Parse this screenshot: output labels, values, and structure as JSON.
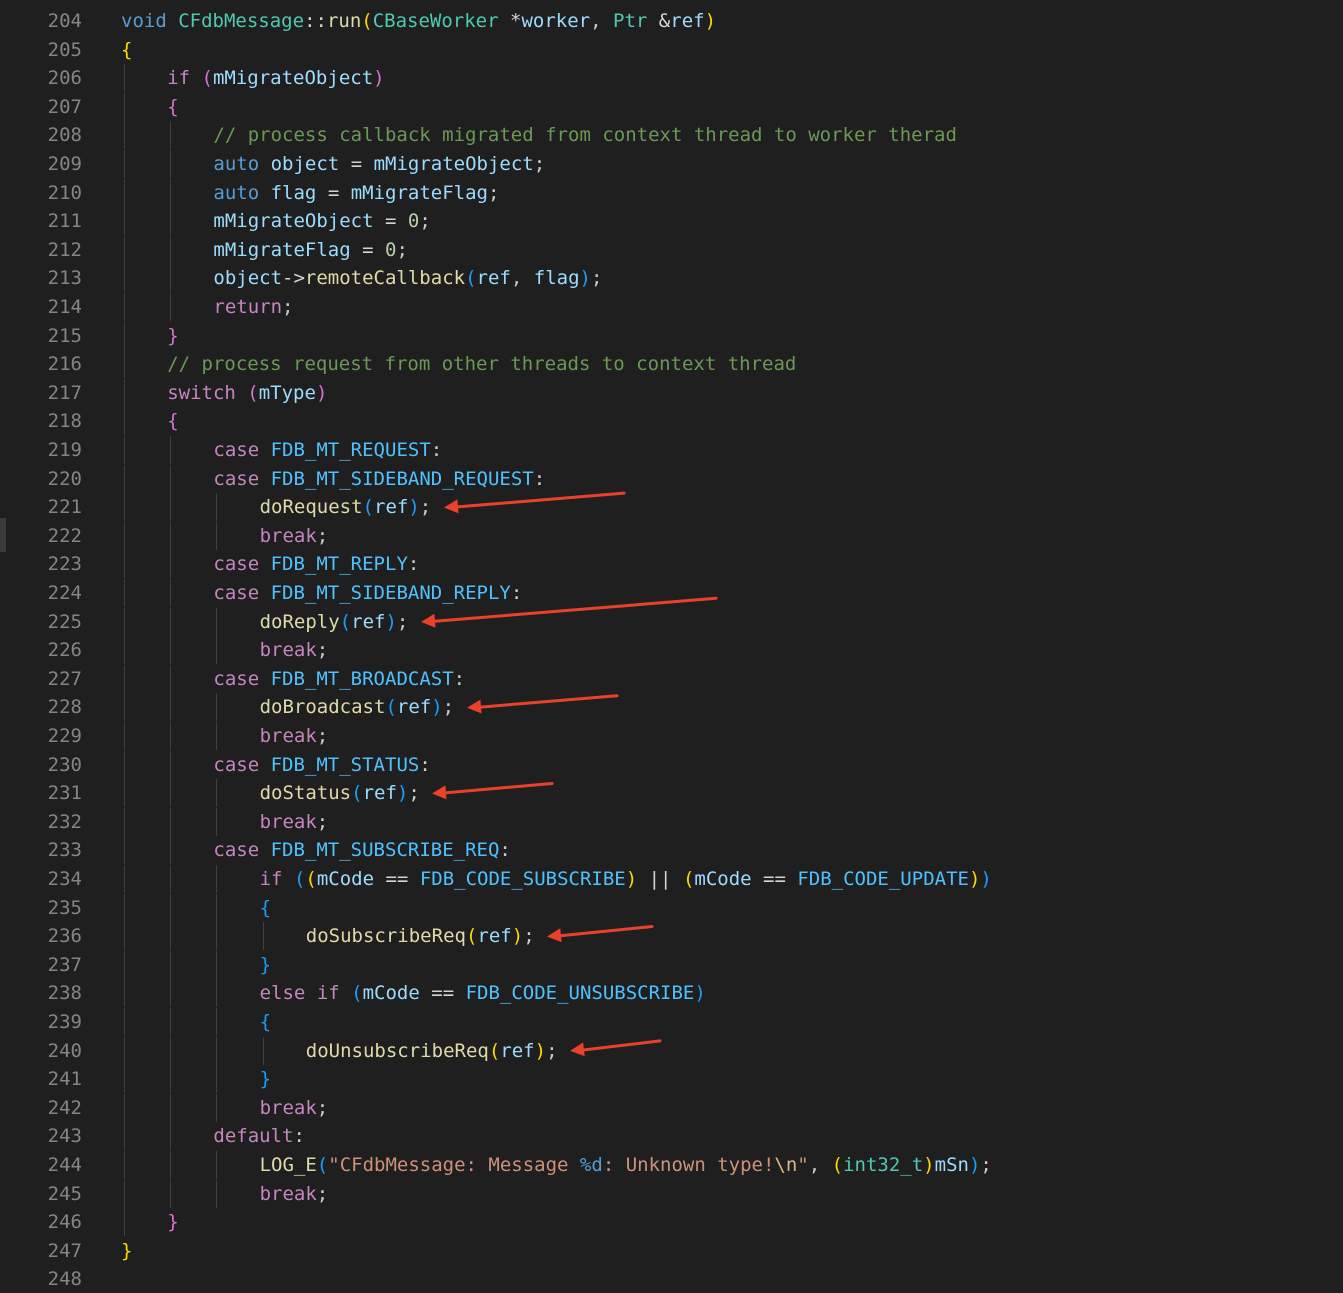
{
  "editor": {
    "lines": [
      {
        "n": "204",
        "indent": 0,
        "tokens": [
          [
            "kw",
            "void"
          ],
          [
            "",
            " "
          ],
          [
            "typ",
            "CFdbMessage"
          ],
          [
            "op",
            "::"
          ],
          [
            "fn",
            "run"
          ],
          [
            "b1",
            "("
          ],
          [
            "typ",
            "CBaseWorker"
          ],
          [
            "",
            " "
          ],
          [
            "op",
            "*"
          ],
          [
            "var",
            "worker"
          ],
          [
            "",
            ", "
          ],
          [
            "typ",
            "Ptr"
          ],
          [
            "",
            " "
          ],
          [
            "op",
            "&"
          ],
          [
            "var",
            "ref"
          ],
          [
            "b1",
            ")"
          ]
        ]
      },
      {
        "n": "205",
        "indent": 0,
        "tokens": [
          [
            "b1",
            "{"
          ]
        ]
      },
      {
        "n": "206",
        "indent": 1,
        "tokens": [
          [
            "ctl",
            "if"
          ],
          [
            "",
            " "
          ],
          [
            "b2",
            "("
          ],
          [
            "var",
            "mMigrateObject"
          ],
          [
            "b2",
            ")"
          ]
        ]
      },
      {
        "n": "207",
        "indent": 1,
        "tokens": [
          [
            "b2",
            "{"
          ]
        ]
      },
      {
        "n": "208",
        "indent": 2,
        "tokens": [
          [
            "cmt",
            "// process callback migrated from context thread to worker therad"
          ]
        ]
      },
      {
        "n": "209",
        "indent": 2,
        "tokens": [
          [
            "kw",
            "auto"
          ],
          [
            "",
            " "
          ],
          [
            "var",
            "object"
          ],
          [
            "op",
            " = "
          ],
          [
            "var",
            "mMigrateObject"
          ],
          [
            "",
            ";"
          ]
        ]
      },
      {
        "n": "210",
        "indent": 2,
        "tokens": [
          [
            "kw",
            "auto"
          ],
          [
            "",
            " "
          ],
          [
            "var",
            "flag"
          ],
          [
            "op",
            " = "
          ],
          [
            "var",
            "mMigrateFlag"
          ],
          [
            "",
            ";"
          ]
        ]
      },
      {
        "n": "211",
        "indent": 2,
        "tokens": [
          [
            "var",
            "mMigrateObject"
          ],
          [
            "op",
            " = "
          ],
          [
            "num",
            "0"
          ],
          [
            "",
            ";"
          ]
        ]
      },
      {
        "n": "212",
        "indent": 2,
        "tokens": [
          [
            "var",
            "mMigrateFlag"
          ],
          [
            "op",
            " = "
          ],
          [
            "num",
            "0"
          ],
          [
            "",
            ";"
          ]
        ]
      },
      {
        "n": "213",
        "indent": 2,
        "tokens": [
          [
            "var",
            "object"
          ],
          [
            "op",
            "->"
          ],
          [
            "fn",
            "remoteCallback"
          ],
          [
            "b3",
            "("
          ],
          [
            "var",
            "ref"
          ],
          [
            "",
            ", "
          ],
          [
            "var",
            "flag"
          ],
          [
            "b3",
            ")"
          ],
          [
            "",
            ";"
          ]
        ]
      },
      {
        "n": "214",
        "indent": 2,
        "tokens": [
          [
            "ctl",
            "return"
          ],
          [
            "",
            ";"
          ]
        ]
      },
      {
        "n": "215",
        "indent": 1,
        "tokens": [
          [
            "b2",
            "}"
          ]
        ]
      },
      {
        "n": "216",
        "indent": 1,
        "tokens": [
          [
            "cmt",
            "// process request from other threads to context thread"
          ]
        ]
      },
      {
        "n": "217",
        "indent": 1,
        "tokens": [
          [
            "ctl",
            "switch"
          ],
          [
            "",
            " "
          ],
          [
            "b2",
            "("
          ],
          [
            "var",
            "mType"
          ],
          [
            "b2",
            ")"
          ]
        ]
      },
      {
        "n": "218",
        "indent": 1,
        "tokens": [
          [
            "b2",
            "{"
          ]
        ]
      },
      {
        "n": "219",
        "indent": 2,
        "tokens": [
          [
            "ctl",
            "case"
          ],
          [
            "",
            " "
          ],
          [
            "mac",
            "FDB_MT_REQUEST"
          ],
          [
            "",
            ":"
          ]
        ]
      },
      {
        "n": "220",
        "indent": 2,
        "tokens": [
          [
            "ctl",
            "case"
          ],
          [
            "",
            " "
          ],
          [
            "mac",
            "FDB_MT_SIDEBAND_REQUEST"
          ],
          [
            "",
            ":"
          ]
        ]
      },
      {
        "n": "221",
        "indent": 3,
        "tokens": [
          [
            "fn",
            "doRequest"
          ],
          [
            "b3",
            "("
          ],
          [
            "var",
            "ref"
          ],
          [
            "b3",
            ")"
          ],
          [
            "",
            ";"
          ]
        ]
      },
      {
        "n": "222",
        "indent": 3,
        "tokens": [
          [
            "ctl",
            "break"
          ],
          [
            "",
            ";"
          ]
        ]
      },
      {
        "n": "223",
        "indent": 2,
        "tokens": [
          [
            "ctl",
            "case"
          ],
          [
            "",
            " "
          ],
          [
            "mac",
            "FDB_MT_REPLY"
          ],
          [
            "",
            ":"
          ]
        ]
      },
      {
        "n": "224",
        "indent": 2,
        "tokens": [
          [
            "ctl",
            "case"
          ],
          [
            "",
            " "
          ],
          [
            "mac",
            "FDB_MT_SIDEBAND_REPLY"
          ],
          [
            "",
            ":"
          ]
        ]
      },
      {
        "n": "225",
        "indent": 3,
        "tokens": [
          [
            "fn",
            "doReply"
          ],
          [
            "b3",
            "("
          ],
          [
            "var",
            "ref"
          ],
          [
            "b3",
            ")"
          ],
          [
            "",
            ";"
          ]
        ]
      },
      {
        "n": "226",
        "indent": 3,
        "tokens": [
          [
            "ctl",
            "break"
          ],
          [
            "",
            ";"
          ]
        ]
      },
      {
        "n": "227",
        "indent": 2,
        "tokens": [
          [
            "ctl",
            "case"
          ],
          [
            "",
            " "
          ],
          [
            "mac",
            "FDB_MT_BROADCAST"
          ],
          [
            "",
            ":"
          ]
        ]
      },
      {
        "n": "228",
        "indent": 3,
        "tokens": [
          [
            "fn",
            "doBroadcast"
          ],
          [
            "b3",
            "("
          ],
          [
            "var",
            "ref"
          ],
          [
            "b3",
            ")"
          ],
          [
            "",
            ";"
          ]
        ]
      },
      {
        "n": "229",
        "indent": 3,
        "tokens": [
          [
            "ctl",
            "break"
          ],
          [
            "",
            ";"
          ]
        ]
      },
      {
        "n": "230",
        "indent": 2,
        "tokens": [
          [
            "ctl",
            "case"
          ],
          [
            "",
            " "
          ],
          [
            "mac",
            "FDB_MT_STATUS"
          ],
          [
            "",
            ":"
          ]
        ]
      },
      {
        "n": "231",
        "indent": 3,
        "tokens": [
          [
            "fn",
            "doStatus"
          ],
          [
            "b3",
            "("
          ],
          [
            "var",
            "ref"
          ],
          [
            "b3",
            ")"
          ],
          [
            "",
            ";"
          ]
        ]
      },
      {
        "n": "232",
        "indent": 3,
        "tokens": [
          [
            "ctl",
            "break"
          ],
          [
            "",
            ";"
          ]
        ]
      },
      {
        "n": "233",
        "indent": 2,
        "tokens": [
          [
            "ctl",
            "case"
          ],
          [
            "",
            " "
          ],
          [
            "mac",
            "FDB_MT_SUBSCRIBE_REQ"
          ],
          [
            "",
            ":"
          ]
        ]
      },
      {
        "n": "234",
        "indent": 3,
        "tokens": [
          [
            "ctl",
            "if"
          ],
          [
            "",
            " "
          ],
          [
            "b3",
            "("
          ],
          [
            "b1",
            "("
          ],
          [
            "var",
            "mCode"
          ],
          [
            "op",
            " == "
          ],
          [
            "mac",
            "FDB_CODE_SUBSCRIBE"
          ],
          [
            "b1",
            ")"
          ],
          [
            "op",
            " || "
          ],
          [
            "b1",
            "("
          ],
          [
            "var",
            "mCode"
          ],
          [
            "op",
            " == "
          ],
          [
            "mac",
            "FDB_CODE_UPDATE"
          ],
          [
            "b1",
            ")"
          ],
          [
            "b3",
            ")"
          ]
        ]
      },
      {
        "n": "235",
        "indent": 3,
        "tokens": [
          [
            "b3",
            "{"
          ]
        ]
      },
      {
        "n": "236",
        "indent": 4,
        "tokens": [
          [
            "fn",
            "doSubscribeReq"
          ],
          [
            "b1",
            "("
          ],
          [
            "var",
            "ref"
          ],
          [
            "b1",
            ")"
          ],
          [
            "",
            ";"
          ]
        ]
      },
      {
        "n": "237",
        "indent": 3,
        "tokens": [
          [
            "b3",
            "}"
          ]
        ]
      },
      {
        "n": "238",
        "indent": 3,
        "tokens": [
          [
            "ctl",
            "else"
          ],
          [
            "",
            " "
          ],
          [
            "ctl",
            "if"
          ],
          [
            "",
            " "
          ],
          [
            "b3",
            "("
          ],
          [
            "var",
            "mCode"
          ],
          [
            "op",
            " == "
          ],
          [
            "mac",
            "FDB_CODE_UNSUBSCRIBE"
          ],
          [
            "b3",
            ")"
          ]
        ]
      },
      {
        "n": "239",
        "indent": 3,
        "tokens": [
          [
            "b3",
            "{"
          ]
        ]
      },
      {
        "n": "240",
        "indent": 4,
        "tokens": [
          [
            "fn",
            "doUnsubscribeReq"
          ],
          [
            "b1",
            "("
          ],
          [
            "var",
            "ref"
          ],
          [
            "b1",
            ")"
          ],
          [
            "",
            ";"
          ]
        ]
      },
      {
        "n": "241",
        "indent": 3,
        "tokens": [
          [
            "b3",
            "}"
          ]
        ]
      },
      {
        "n": "242",
        "indent": 3,
        "tokens": [
          [
            "ctl",
            "break"
          ],
          [
            "",
            ";"
          ]
        ]
      },
      {
        "n": "243",
        "indent": 2,
        "tokens": [
          [
            "ctl",
            "default"
          ],
          [
            "",
            ":"
          ]
        ]
      },
      {
        "n": "244",
        "indent": 3,
        "tokens": [
          [
            "fn",
            "LOG_E"
          ],
          [
            "b3",
            "("
          ],
          [
            "str",
            "\"CFdbMessage: Message "
          ],
          [
            "kw",
            "%d"
          ],
          [
            "str",
            ": Unknown type!"
          ],
          [
            "esc",
            "\\n"
          ],
          [
            "str",
            "\""
          ],
          [
            "",
            ", "
          ],
          [
            "b1",
            "("
          ],
          [
            "typ",
            "int32_t"
          ],
          [
            "b1",
            ")"
          ],
          [
            "var",
            "mSn"
          ],
          [
            "b3",
            ")"
          ],
          [
            "",
            ";"
          ]
        ]
      },
      {
        "n": "245",
        "indent": 3,
        "tokens": [
          [
            "ctl",
            "break"
          ],
          [
            "",
            ";"
          ]
        ]
      },
      {
        "n": "246",
        "indent": 1,
        "tokens": [
          [
            "b2",
            "}"
          ]
        ]
      },
      {
        "n": "247",
        "indent": 0,
        "tokens": [
          [
            "b1",
            "}"
          ]
        ]
      },
      {
        "n": "248",
        "indent": 0,
        "tokens": []
      }
    ]
  },
  "annotations": {
    "arrow_color": "#e8412c",
    "arrows": [
      {
        "line": "221"
      },
      {
        "line": "225"
      },
      {
        "line": "228"
      },
      {
        "line": "231"
      },
      {
        "line": "236"
      },
      {
        "line": "240"
      }
    ]
  },
  "colors": {
    "background": "#1f1f1f",
    "line_number": "#858585",
    "keyword": "#569cd6",
    "control": "#c586c0",
    "function": "#dcdcaa",
    "variable": "#9cdcfe",
    "macro": "#4fc1ff",
    "comment": "#6a9955"
  }
}
